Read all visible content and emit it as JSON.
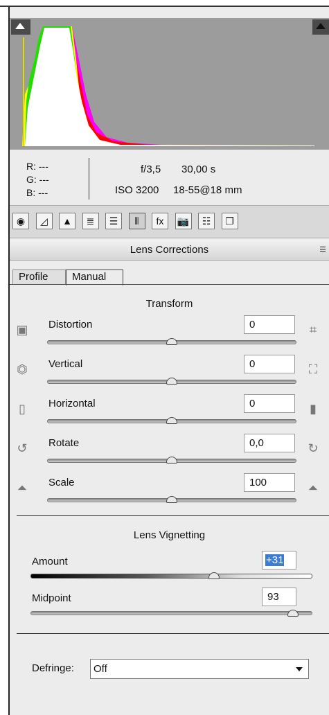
{
  "histogram": {
    "series": [
      {
        "name": "white",
        "color": "#ffffff"
      },
      {
        "name": "green",
        "color": "#22dd00"
      },
      {
        "name": "yellow",
        "color": "#ffff00"
      },
      {
        "name": "red",
        "color": "#ff0000"
      },
      {
        "name": "magenta",
        "color": "#ff00ff"
      }
    ]
  },
  "info": {
    "r_label": "R:",
    "r_value": "---",
    "g_label": "G:",
    "g_value": "---",
    "b_label": "B:",
    "b_value": "---",
    "aperture": "f/3,5",
    "shutter": "30,00 s",
    "iso": "ISO 3200",
    "lens": "18-55@18 mm"
  },
  "toolbar": {
    "icons": [
      {
        "name": "basic-icon",
        "glyph": "◉"
      },
      {
        "name": "tone-curve-icon",
        "glyph": "◿"
      },
      {
        "name": "detail-icon",
        "glyph": "▲"
      },
      {
        "name": "hsl-icon",
        "glyph": "≣"
      },
      {
        "name": "split-toning-icon",
        "glyph": "☰"
      },
      {
        "name": "lens-corrections-icon",
        "glyph": "⦀"
      },
      {
        "name": "effects-icon",
        "glyph": "fx"
      },
      {
        "name": "camera-calibration-icon",
        "glyph": "📷"
      },
      {
        "name": "presets-icon",
        "glyph": "☷"
      },
      {
        "name": "snapshots-icon",
        "glyph": "❐"
      }
    ],
    "active_index": 5
  },
  "panel_title": "Lens Corrections",
  "tabs": [
    "Profile",
    "Manual"
  ],
  "transform": {
    "title": "Transform",
    "rows": [
      {
        "label": "Distortion",
        "value": "0",
        "thumb": 0.5
      },
      {
        "label": "Vertical",
        "value": "0",
        "thumb": 0.5
      },
      {
        "label": "Horizontal",
        "value": "0",
        "thumb": 0.5
      },
      {
        "label": "Rotate",
        "value": "0,0",
        "thumb": 0.5
      },
      {
        "label": "Scale",
        "value": "100",
        "thumb": 0.5
      }
    ]
  },
  "vignetting": {
    "title": "Lens Vignetting",
    "amount_label": "Amount",
    "amount_value": "+31",
    "amount_thumb": 0.65,
    "midpoint_label": "Midpoint",
    "midpoint_value": "93",
    "midpoint_thumb": 0.93
  },
  "defringe": {
    "label": "Defringe:",
    "value": "Off"
  }
}
